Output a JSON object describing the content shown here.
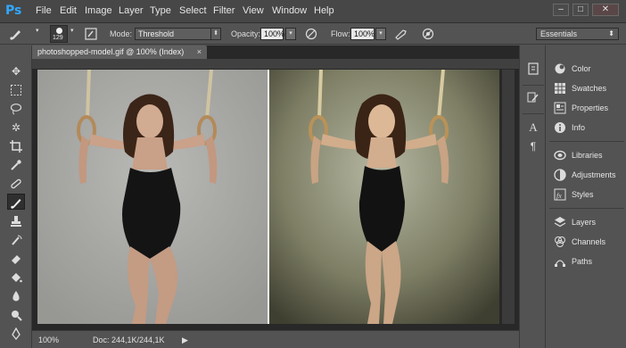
{
  "app": {
    "logo": "Ps"
  },
  "menu": [
    "File",
    "Edit",
    "Image",
    "Layer",
    "Type",
    "Select",
    "Filter",
    "View",
    "Window",
    "Help"
  ],
  "window_controls": {
    "minimize": "–",
    "restore": "□",
    "close": "✕"
  },
  "options": {
    "brush_size": "129",
    "mode_label": "Mode:",
    "mode_value": "Threshold",
    "opacity_label": "Opacity:",
    "opacity_value": "100%",
    "flow_label": "Flow:",
    "flow_value": "100%",
    "workspace": "Essentials"
  },
  "document": {
    "tab_title": "photoshopped-model.gif @ 100% (Index)",
    "tab_close": "×",
    "zoom": "100%",
    "doc_info": "Doc: 244,1K/244,1K",
    "status_arrow": "▶"
  },
  "panels": [
    {
      "label": "Color",
      "icon": "color-icon"
    },
    {
      "label": "Swatches",
      "icon": "swatches-icon"
    },
    {
      "label": "Properties",
      "icon": "properties-icon"
    },
    {
      "label": "Info",
      "icon": "info-icon"
    },
    {
      "label": "Libraries",
      "icon": "libraries-icon"
    },
    {
      "label": "Adjustments",
      "icon": "adjustments-icon"
    },
    {
      "label": "Styles",
      "icon": "styles-icon"
    },
    {
      "label": "Layers",
      "icon": "layers-icon"
    },
    {
      "label": "Channels",
      "icon": "channels-icon"
    },
    {
      "label": "Paths",
      "icon": "paths-icon"
    }
  ],
  "colors": {
    "ui_background": "#535353",
    "menu_background": "#474747",
    "logo_blue": "#31a8ff",
    "canvas_left_bg": "#a8a8a5",
    "canvas_right_bg": "#6d6e55"
  }
}
